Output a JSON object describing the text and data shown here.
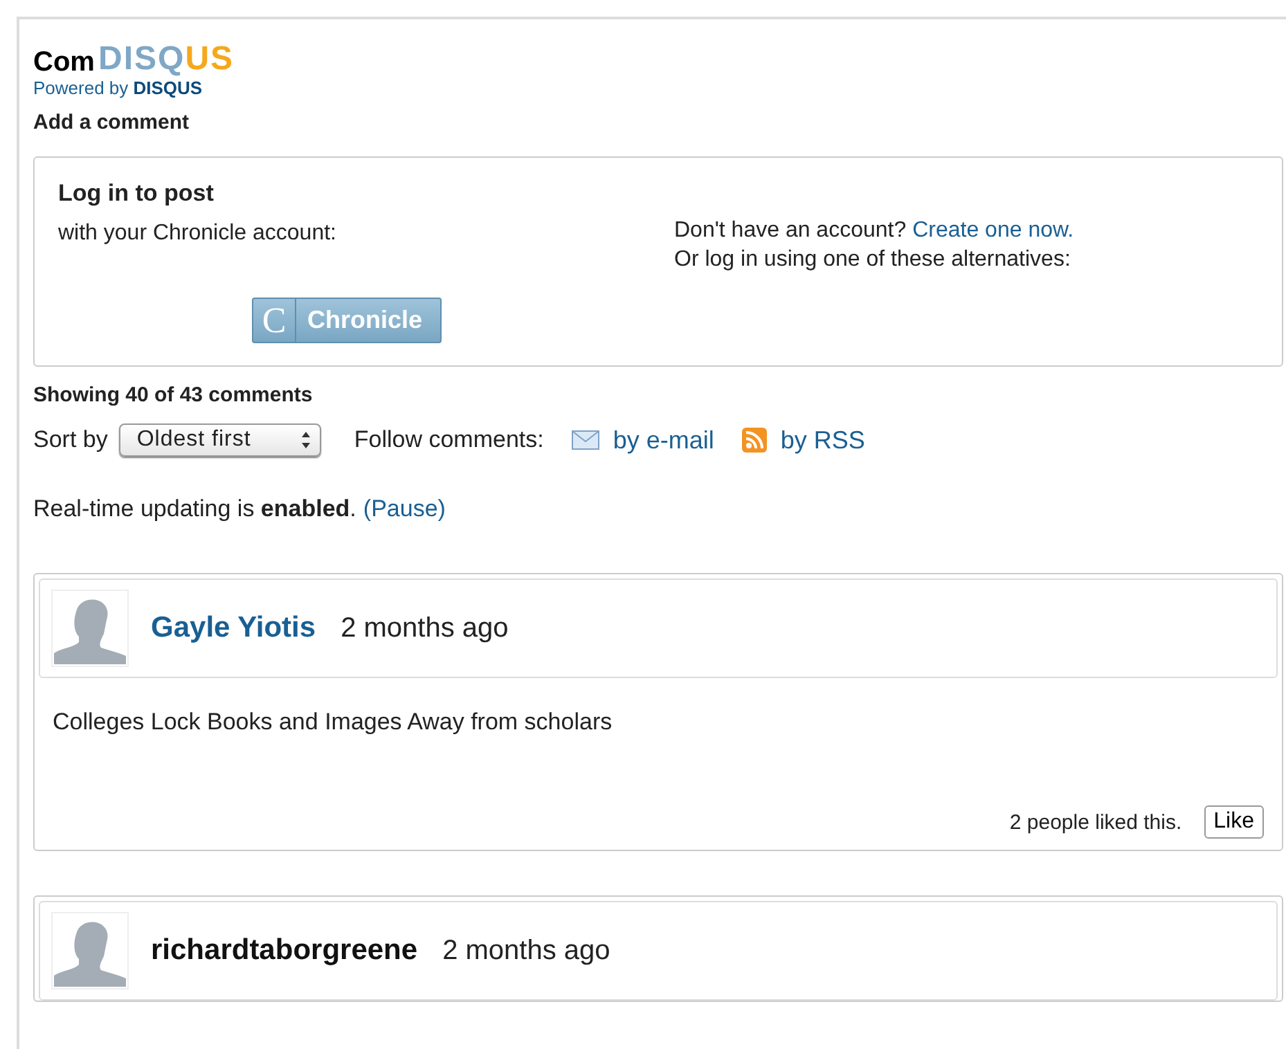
{
  "header": {
    "title": "Com",
    "logo": "DISQUS",
    "powered_by": "Powered by **DISQUS**"
  },
  "add_comment": "Add a comment",
  "login": {
    "title": "Log in to post",
    "with_account": "with your Chronicle account:",
    "login_button": {
      "glyph": "C",
      "label": "Chronicle"
    },
    "no_account": "Don't have an account?",
    "create_link": "Create one now.",
    "alternatives": "Or log in using one of these alternatives:"
  },
  "count": "Showing 40 of 43 comments",
  "sort": {
    "label": "Sort by",
    "value": "Oldest first"
  },
  "follow": {
    "label": "Follow comments:",
    "links": [
      {
        "kind": "email",
        "label": "by e-mail"
      },
      {
        "kind": "rss",
        "label": "by RSS"
      }
    ]
  },
  "realtime": {
    "text": "Real-time updating is **enabled**.",
    "link": "(Pause)"
  },
  "comments": [
    {
      "author": "Gayle Yiotis",
      "linked": true,
      "time": "2 months ago",
      "body": "Colleges Lock Books and Images Away from scholars",
      "likes": "2 people liked this.",
      "like_button": "Like"
    },
    {
      "author": "richardtaborgreene",
      "linked": false,
      "time": "2 months ago"
    }
  ]
}
